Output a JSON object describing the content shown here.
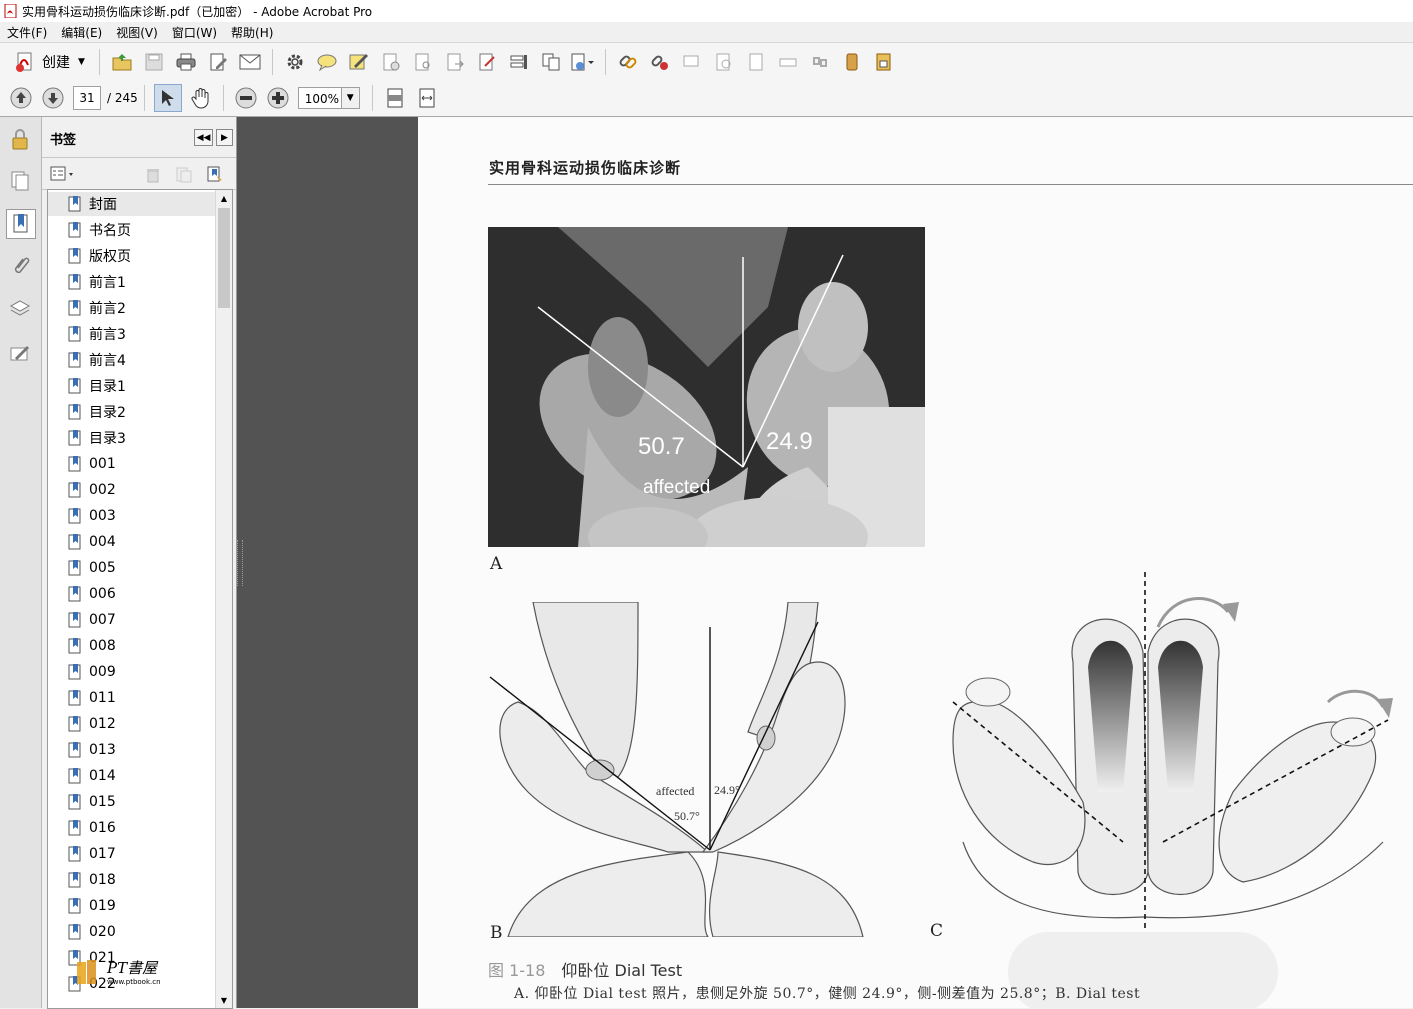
{
  "window": {
    "title": "实用骨科运动损伤临床诊断.pdf（已加密） - Adobe Acrobat Pro"
  },
  "menu": [
    "文件(F)",
    "编辑(E)",
    "视图(V)",
    "窗口(W)",
    "帮助(H)"
  ],
  "toolbar": {
    "create_label": "创建"
  },
  "nav": {
    "current_page": "31",
    "total_pages": "/ 245",
    "zoom": "100%"
  },
  "panel": {
    "title": "书签",
    "bookmarks": [
      "封面",
      "书名页",
      "版权页",
      "前言1",
      "前言2",
      "前言3",
      "前言4",
      "目录1",
      "目录2",
      "目录3",
      "001",
      "002",
      "003",
      "004",
      "005",
      "006",
      "007",
      "008",
      "009",
      "011",
      "012",
      "013",
      "014",
      "015",
      "016",
      "017",
      "018",
      "019",
      "020",
      "021",
      "022"
    ]
  },
  "document": {
    "running_head": "实用骨科运动损伤临床诊断",
    "photo_labels": {
      "left_angle": "50.7",
      "right_angle": "24.9",
      "affected": "affected"
    },
    "drawing_labels": {
      "affected": "affected",
      "right_angle": "24.9°",
      "left_angle": "50.7°"
    },
    "panel_labels": {
      "a": "A",
      "b": "B",
      "c": "C"
    },
    "caption_number": "图 1-18",
    "caption_title": "仰卧位 Dial Test",
    "caption_text": "A. 仰卧位 Dial test 照片，患侧足外旋 50.7°，健侧 24.9°，侧-侧差值为 25.8°；B. Dial test"
  },
  "watermark": {
    "text": "PT書屋",
    "url": "www.ptbook.cn"
  },
  "colors": {
    "gutter": "#535353",
    "page": "#fbfbfb",
    "arrow": "#999999"
  }
}
